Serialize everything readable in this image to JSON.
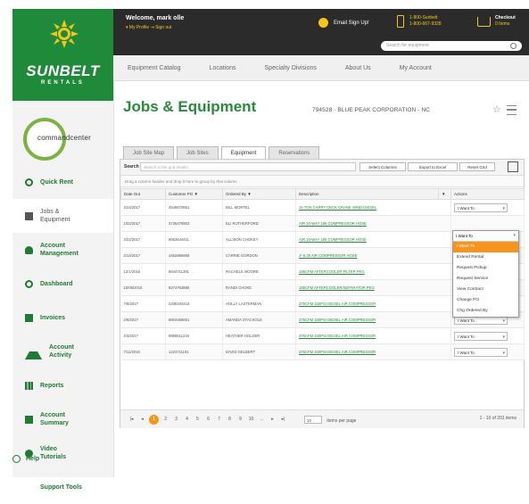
{
  "brand": {
    "name": "SUNBELT",
    "sub": "RENTALS",
    "green": "#1f8a3a",
    "orange": "#f7941d",
    "yellow": "#f5c518"
  },
  "commandcenter": {
    "label": "commandcenter"
  },
  "sidebar": {
    "items": [
      {
        "label": "Quick Rent",
        "icon": "circle-icon"
      },
      {
        "label": "Jobs & Equipment",
        "icon": "list-icon",
        "active": true
      },
      {
        "label": "Account Management",
        "icon": "person-icon"
      },
      {
        "label": "Dashboard",
        "icon": "dashboard-icon"
      },
      {
        "label": "Invoices",
        "icon": "invoice-icon"
      },
      {
        "label": "Account Activity",
        "icon": "activity-icon"
      },
      {
        "label": "Reports",
        "icon": "bar-chart-icon"
      },
      {
        "label": "Account Summary",
        "icon": "summary-icon"
      },
      {
        "label": "Video Tutorials",
        "icon": "play-icon"
      },
      {
        "label": "Support Tools",
        "icon": ""
      }
    ],
    "help": "Help"
  },
  "topbar": {
    "welcome": "Welcome, mark olle",
    "welcome_links": "▾ My Profile  ⇥ Sign out",
    "email_signup": "Email Sign Up!",
    "phone_line1": "1-800-Sunbelt",
    "phone_line2": "1-800-667-9328",
    "checkout": "Checkout",
    "checkout_items": "0 Items",
    "search_placeholder": "Search for equipment"
  },
  "mainnav": [
    "Equipment Catalog",
    "Locations",
    "Specialty Divisions",
    "About Us",
    "My Account"
  ],
  "page": {
    "title": "Jobs & Equipment",
    "account": "794528 · BLUE PEAK CORPORATION - NC"
  },
  "tabs": [
    {
      "label": "Job Site Map"
    },
    {
      "label": "Job Sites"
    },
    {
      "label": "Equipment",
      "active": true
    },
    {
      "label": "Reservations"
    }
  ],
  "toolbar": {
    "search_label": "Search",
    "search_placeholder": "Search in the grid results",
    "select_columns": "Select Columns",
    "export_excel": "Export to Excel",
    "reset_grid": "Reset Grid",
    "group_hint": "Drag a column header and drop it here to group by that column"
  },
  "table": {
    "headers": [
      "Date Out",
      "Customer PO ▼",
      "Ordered By ▼",
      "Description",
      "▼",
      "Actions"
    ],
    "rows": [
      [
        "2/24/2017",
        "4548670861",
        "BILL MORTEL",
        "15 TON CARRY DECK CRANE WIND DIESEL",
        "I Want To"
      ],
      [
        "1/02/2017",
        "4735478903",
        "ELI RUTHERFORD",
        "AIR 10-WAY 185 COMPRESSOR HOSE",
        ""
      ],
      [
        "2/22/2017",
        "6663644411",
        "ALLISON CHOKEY",
        "AIR 10-WAY 185 COMPRESSOR HOSE",
        ""
      ],
      [
        "2/14/2017",
        "4462866968",
        "CARRIE GORDON",
        "J* 6.30 AIR COMPRESSOR HOSE",
        ""
      ],
      [
        "12/1/2016",
        "6644711381",
        "RACHELE MOORE",
        "185CFM AFTERCOOLER FILTER PKG",
        ""
      ],
      [
        "10/05/2016",
        "8274763886",
        "RANDI CHOKE",
        "185CFM AFTERCOOLER/SEPARATOR PKG",
        ""
      ],
      [
        "7/6/2017",
        "2336192416",
        "HOLLY LASTERMAN",
        "375CFM 150PSI DIESEL AIR COMPRESSOR",
        "I Want To"
      ],
      [
        "2/6/2017",
        "8604456661",
        "AMANDA STACKOLE",
        "375CFM 150PSI DIESEL AIR COMPRESSOR",
        "I Want To"
      ],
      [
        "2/3/2017",
        "8868611234",
        "HEATHER HOLDER",
        "375CFM 150PSI DIESEL AIR COMPRESSOR",
        "I Want To"
      ],
      [
        "7/11/2016",
        "1223711191",
        "DAVID GELBERT",
        "375CFM 150PSI DIESEL AIR COMPRESSOR",
        "I Want To"
      ]
    ]
  },
  "dropdown": {
    "selected": "I Want To",
    "items": [
      {
        "label": "I Want To",
        "highlight": true
      },
      {
        "label": "Extend Rental"
      },
      {
        "label": "Request Pickup"
      },
      {
        "label": "Request Service"
      },
      {
        "label": "View Contract"
      },
      {
        "label": "Change PO"
      },
      {
        "label": "Chg Ordered By"
      }
    ]
  },
  "pager": {
    "pages": [
      "1",
      "2",
      "3",
      "4",
      "5",
      "6",
      "7",
      "8",
      "9",
      "10",
      "..."
    ],
    "current": "1",
    "page_size": "10",
    "items_per_page": "items per page",
    "range": "1 - 10 of 201 items"
  }
}
